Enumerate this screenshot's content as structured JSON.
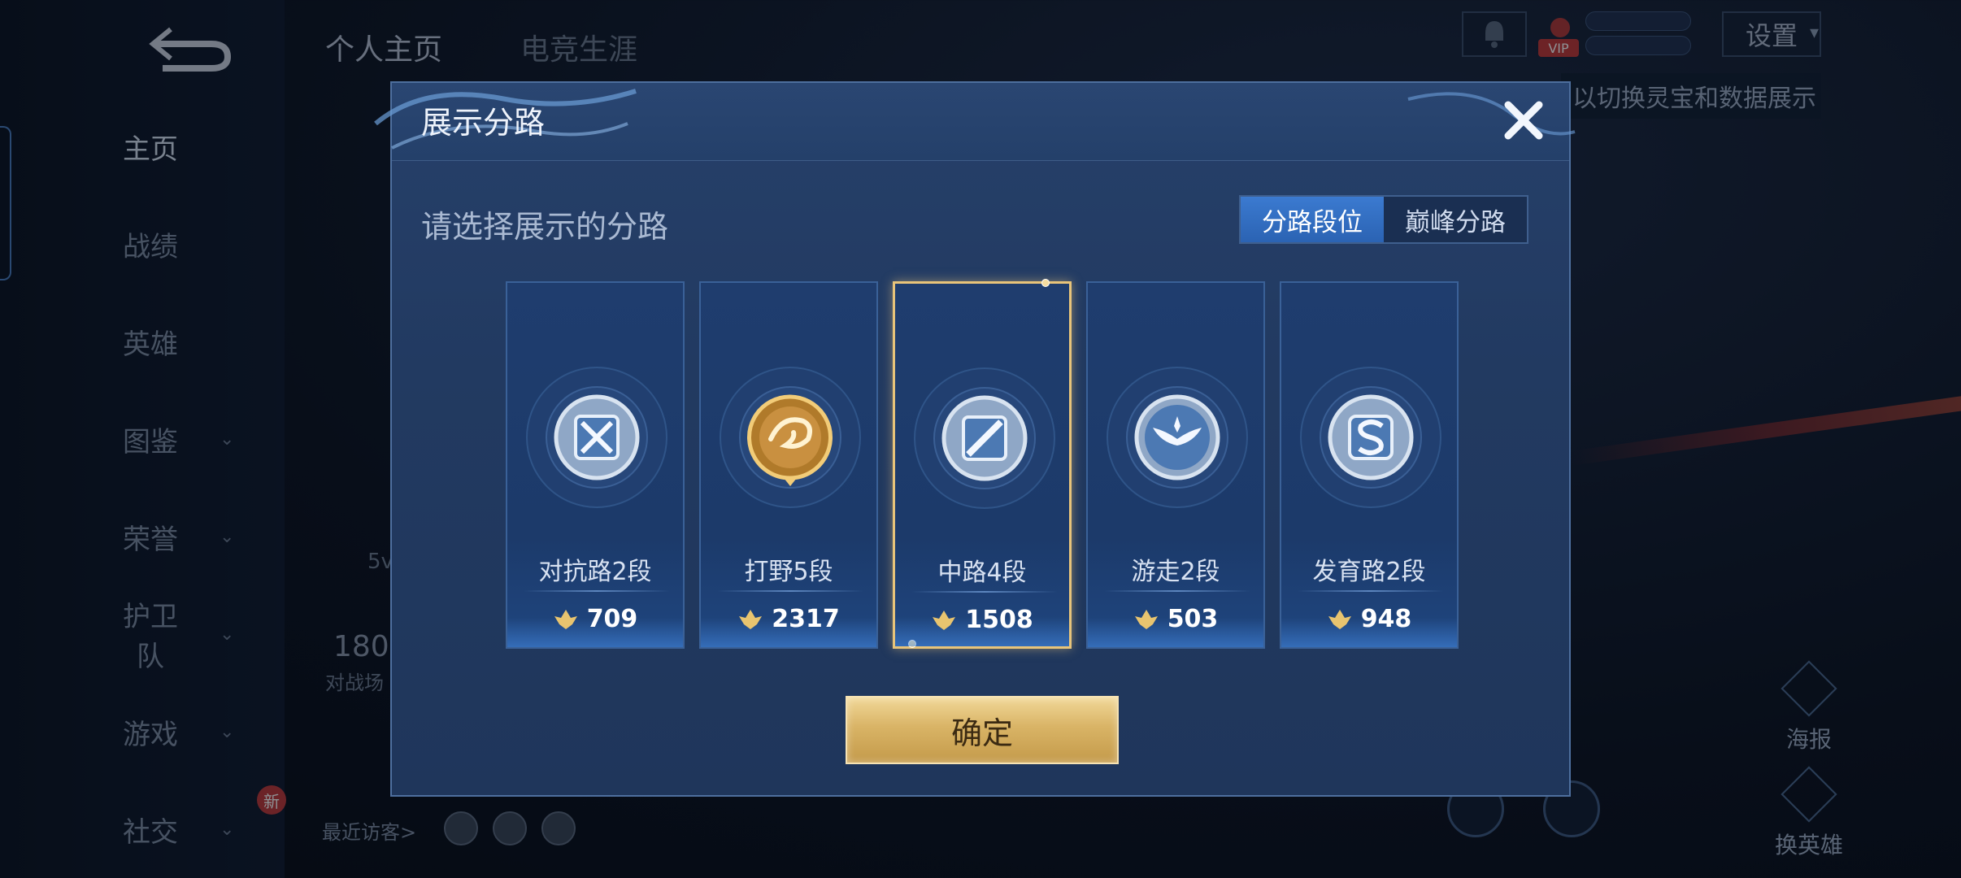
{
  "sidebar": {
    "items": [
      {
        "label": "主页",
        "active": true,
        "has_dropdown": false
      },
      {
        "label": "战绩",
        "has_dropdown": false
      },
      {
        "label": "英雄",
        "has_dropdown": false
      },
      {
        "label": "图鉴",
        "has_dropdown": true
      },
      {
        "label": "荣誉",
        "has_dropdown": true
      },
      {
        "label": "护卫队",
        "has_dropdown": true
      },
      {
        "label": "游戏",
        "has_dropdown": true
      },
      {
        "label": "社交",
        "has_dropdown": true,
        "badge": "新"
      }
    ]
  },
  "top_tabs": [
    "个人主页",
    "电竞生涯"
  ],
  "top_right": {
    "settings_label": "设置",
    "hint_text": "以切换灵宝和数据展示",
    "vip_label": "VIP"
  },
  "background": {
    "stat_value": "180",
    "stat_label": "对战场",
    "recent_visitors_label": "最近访客>",
    "partial_text": "5v"
  },
  "right_actions": [
    {
      "label": "海报",
      "icon": "poster-icon"
    },
    {
      "label": "换英雄",
      "icon": "switch-hero-icon"
    }
  ],
  "modal": {
    "title": "展示分路",
    "subtitle": "请选择展示的分路",
    "segments": [
      {
        "label": "分路段位",
        "active": true
      },
      {
        "label": "巅峰分路",
        "active": false
      }
    ],
    "confirm_label": "确定",
    "selected_index": 2,
    "lanes": [
      {
        "name": "对抗路2段",
        "score": "709",
        "icon": "clash-lane-emblem",
        "tier": "silver"
      },
      {
        "name": "打野5段",
        "score": "2317",
        "icon": "jungle-dragon-emblem",
        "tier": "gold"
      },
      {
        "name": "中路4段",
        "score": "1508",
        "icon": "mid-lane-emblem",
        "tier": "silver"
      },
      {
        "name": "游走2段",
        "score": "503",
        "icon": "roam-wings-emblem",
        "tier": "silver"
      },
      {
        "name": "发育路2段",
        "score": "948",
        "icon": "farm-lane-emblem",
        "tier": "silver"
      }
    ]
  },
  "colors": {
    "modal_bg": "#223a61",
    "active_segment": "#2f6cc0",
    "selected_border": "#e8c47a",
    "confirm_gold": "#d9b466"
  }
}
